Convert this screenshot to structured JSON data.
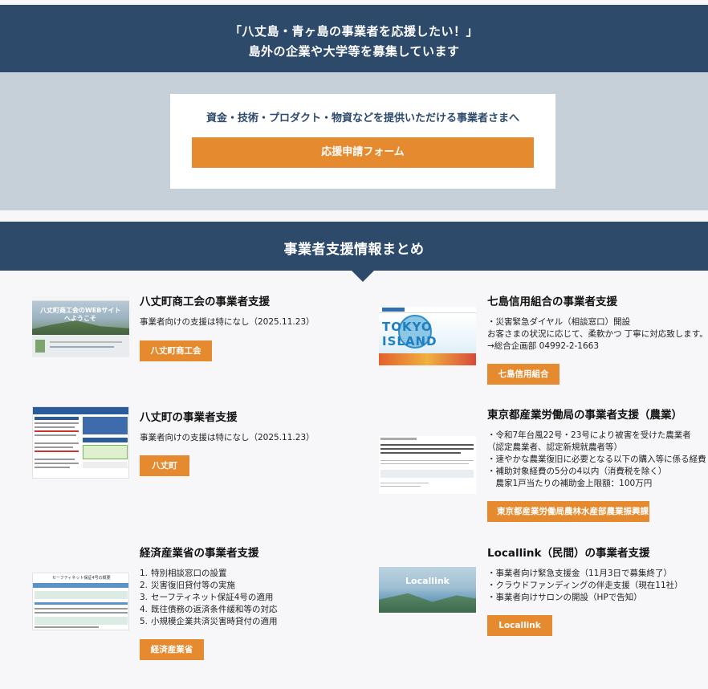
{
  "top_banner": {
    "line1": "「八丈島・青ヶ島の事業者を応援したい！」",
    "line2": "島外の企業や大学等を募集しています"
  },
  "cta": {
    "lead": "資金・技術・プロダクト・物資などを提供いただける事業者さまへ",
    "button": "応援申請フォーム"
  },
  "section": {
    "title": "事業者支援情報まとめ"
  },
  "cards": {
    "shokokai": {
      "title": "八丈町商工会の事業者支援",
      "body": "事業者向けの支援は特になし（2025.11.23）",
      "button": "八丈町商工会",
      "thumb_text1": "八丈町商工会のWEBサイト",
      "thumb_text2": "へようこそ"
    },
    "shichito": {
      "title": "七島信用組合の事業者支援",
      "body": [
        "・災害緊急ダイヤル（相談窓口）開設",
        "お客さまの状況に応じて、柔軟かつ 丁寧に対応致します。",
        "→総合企画部 04992-2-1663"
      ],
      "button": "七島信用組合",
      "thumb_text": "TOKYO ISLAND"
    },
    "town": {
      "title": "八丈町の事業者支援",
      "body": "事業者向けの支援は特になし（2025.11.23）",
      "button": "八丈町"
    },
    "tokyo": {
      "title": "東京都産業労働局の事業者支援（農業）",
      "body": [
        "・令和7年台風22号・23号により被害を受けた農業者",
        "（認定農業者、認定新規就農者等）",
        "・速やかな農業復旧に必要となる以下の購入等に係る経費",
        "・補助対象経費の5分の4以内（消費税を除く）",
        "　農家1戸当たりの補助金上限額：100万円"
      ],
      "button": "東京都産業労働局農林水産部農業振興課"
    },
    "meti": {
      "title": "経済産業省の事業者支援",
      "items": [
        "特別相談窓口の設置",
        "災害復旧貸付等の実施",
        "セーフティネット保証4号の適用",
        "既往債務の返済条件緩和等の対応",
        "小規模企業共済災害時貸付の適用"
      ],
      "button": "経済産業省",
      "thumb_text": "セーフティネット保証4号の概要"
    },
    "locallink": {
      "title": "Locallink（民間）の事業者支援",
      "body": [
        "・事業者向け緊急支援金（11月3日で募集終了）",
        "・クラウドファンディングの伴走支援（現在11社）",
        "・事業者向けサロンの開設（HPで告知）"
      ],
      "button": "Locallink",
      "thumb_text": "Locallink"
    }
  },
  "colors": {
    "navy": "#2d4a6b",
    "orange": "#e58a2e",
    "gray_band": "#c6d0d8"
  }
}
